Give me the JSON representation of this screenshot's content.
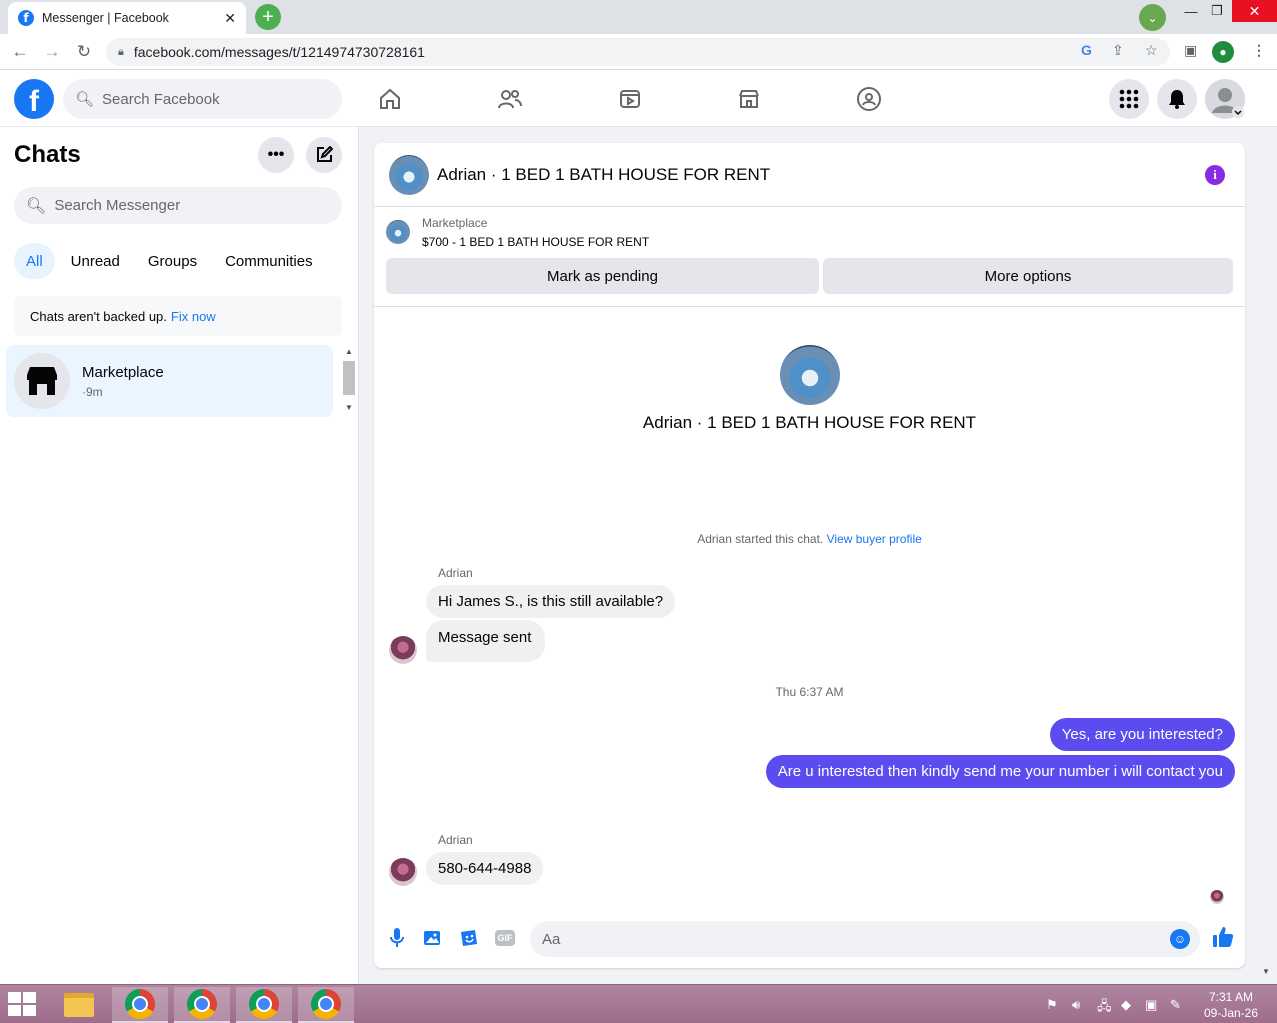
{
  "browser": {
    "tab_title": "Messenger | Facebook",
    "url": "facebook.com/messages/t/1214974730728161"
  },
  "fbnav": {
    "search_placeholder": "Search Facebook"
  },
  "sidebar": {
    "title": "Chats",
    "search_placeholder": "Search Messenger",
    "filters": [
      "All",
      "Unread",
      "Groups",
      "Communities"
    ],
    "backup_text": "Chats aren't backed up.",
    "backup_link": "Fix now",
    "chats": [
      {
        "name": "Marketplace",
        "time": "·9m"
      }
    ]
  },
  "conversation": {
    "title": "Adrian · 1 BED 1 BATH HOUSE FOR RENT",
    "marketplace_label": "Marketplace",
    "listing": "$700 - 1 BED 1 BATH HOUSE FOR RENT",
    "mark_pending": "Mark as pending",
    "more_options": "More options",
    "center_name": "Adrian · 1 BED 1 BATH HOUSE FOR RENT",
    "started_text": "Adrian started this chat.",
    "started_link": "View buyer profile",
    "messages": [
      {
        "sender": "Adrian",
        "text": "Hi James S., is this still available?"
      },
      {
        "text": "Message sent"
      },
      {
        "timestamp": "Thu 6:37 AM"
      },
      {
        "outgoing": true,
        "text": "Yes, are you interested?"
      },
      {
        "outgoing": true,
        "text": "Are u interested then kindly send me your number i will contact you"
      },
      {
        "sender": "Adrian",
        "text": "580-644-4988"
      }
    ],
    "composer_placeholder": "Aa",
    "gif_label": "GIF"
  },
  "taskbar": {
    "time": "7:31 AM",
    "date": "09-Jan-26"
  },
  "colors": {
    "fb_blue": "#1877f2",
    "outgoing_bubble": "#5b4cf0",
    "info_purple": "#8a2be2"
  }
}
